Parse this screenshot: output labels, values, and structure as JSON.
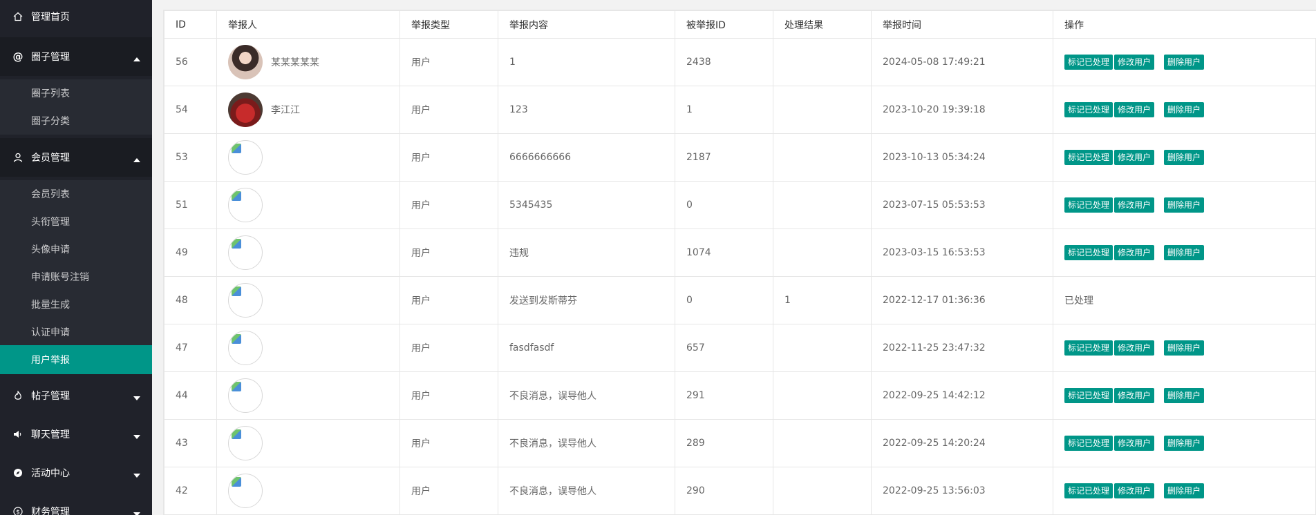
{
  "sidebar": {
    "home": "管理首页",
    "circle_group": "圈子管理",
    "circle_list": "圈子列表",
    "circle_category": "圈子分类",
    "member_group": "会员管理",
    "member_list": "会员列表",
    "title_manage": "头衔管理",
    "avatar_apply": "头像申请",
    "account_cancel": "申请账号注销",
    "batch_generate": "批量生成",
    "cert_apply": "认证申请",
    "user_report": "用户举报",
    "post_group": "帖子管理",
    "chat_group": "聊天管理",
    "activity_group": "活动中心",
    "finance_group": "财务管理"
  },
  "table": {
    "headers": [
      "ID",
      "举报人",
      "举报类型",
      "举报内容",
      "被举报ID",
      "处理结果",
      "举报时间",
      "操作"
    ],
    "actions": {
      "mark": "标记已处理",
      "edit": "修改用户",
      "delete": "删除用户"
    },
    "rows": [
      {
        "id": "56",
        "reporter": "某某某某某",
        "type": "用户",
        "content": "1",
        "target": "2438",
        "result": "",
        "time": "2024-05-08 17:49:21",
        "status": ""
      },
      {
        "id": "54",
        "reporter": "李江江",
        "type": "用户",
        "content": "123",
        "target": "1",
        "result": "",
        "time": "2023-10-20 19:39:18",
        "status": ""
      },
      {
        "id": "53",
        "reporter": "",
        "type": "用户",
        "content": "6666666666",
        "target": "2187",
        "result": "",
        "time": "2023-10-13 05:34:24",
        "status": ""
      },
      {
        "id": "51",
        "reporter": "",
        "type": "用户",
        "content": "5345435",
        "target": "0",
        "result": "",
        "time": "2023-07-15 05:53:53",
        "status": ""
      },
      {
        "id": "49",
        "reporter": "",
        "type": "用户",
        "content": "违规",
        "target": "1074",
        "result": "",
        "time": "2023-03-15 16:53:53",
        "status": ""
      },
      {
        "id": "48",
        "reporter": "",
        "type": "用户",
        "content": "发送到发斯蒂芬",
        "target": "0",
        "result": "1",
        "time": "2022-12-17 01:36:36",
        "status": "已处理"
      },
      {
        "id": "47",
        "reporter": "",
        "type": "用户",
        "content": "fasdfasdf",
        "target": "657",
        "result": "",
        "time": "2022-11-25 23:47:32",
        "status": ""
      },
      {
        "id": "44",
        "reporter": "",
        "type": "用户",
        "content": "不良消息，误导他人",
        "target": "291",
        "result": "",
        "time": "2022-09-25 14:42:12",
        "status": ""
      },
      {
        "id": "43",
        "reporter": "",
        "type": "用户",
        "content": "不良消息，误导他人",
        "target": "289",
        "result": "",
        "time": "2022-09-25 14:20:24",
        "status": ""
      },
      {
        "id": "42",
        "reporter": "",
        "type": "用户",
        "content": "不良消息，误导他人",
        "target": "290",
        "result": "",
        "time": "2022-09-25 13:56:03",
        "status": ""
      }
    ]
  },
  "colors": {
    "accent": "#009688",
    "sidebar_bg": "#20222a",
    "sidebar_child_bg": "#282b33"
  },
  "icons": [
    "home-icon",
    "at-icon",
    "user-icon",
    "fire-icon",
    "speaker-icon",
    "compass-icon",
    "money-icon",
    "caret-up-icon",
    "caret-down-icon"
  ]
}
